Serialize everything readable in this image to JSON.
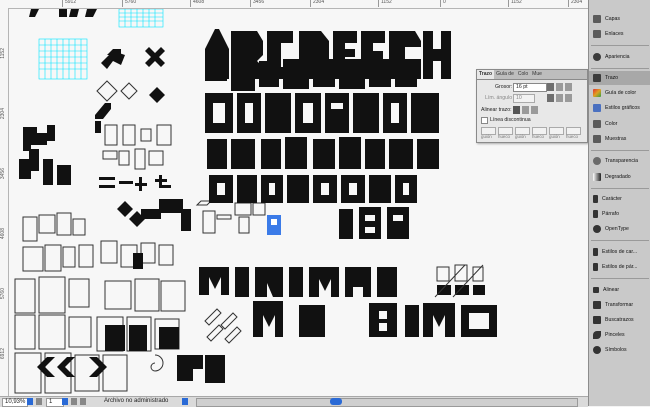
{
  "ruler": {
    "top_ticks": [
      "5912",
      "5760",
      "4608",
      "3456",
      "2304",
      "1152",
      "0",
      "1152",
      "2304",
      "3456",
      "4608",
      "5760",
      "6912"
    ],
    "left_ticks": [
      "0",
      "1152",
      "2304",
      "3456",
      "4608",
      "5760",
      "6912"
    ]
  },
  "status": {
    "zoom": "10,93%",
    "page": "1",
    "file_status": "Archivo no administrado"
  },
  "stroke_panel": {
    "tabs": [
      "Trazo",
      "Guía de",
      "Colo",
      "Mue"
    ],
    "weight_label": "Grosor:",
    "weight_value": "16 pt",
    "miter_label": "Lím. ángulo",
    "miter_value": "10",
    "align_label": "Alinear trazo:",
    "dashed_label": "Línea discontinua",
    "dash_fields": [
      "guión",
      "hueco",
      "guión",
      "hueco",
      "guión",
      "hueco"
    ]
  },
  "dock": {
    "items": [
      {
        "label": "Capas",
        "icon": "layers-icon",
        "color": "#5b5b5b"
      },
      {
        "label": "Enlaces",
        "icon": "links-icon",
        "color": "#5b5b5b"
      },
      {
        "label": "Apariencia",
        "icon": "appearance-icon",
        "color": "#3c3c3c"
      },
      {
        "label": "Trazo",
        "icon": "stroke-icon",
        "color": "#3c3c3c"
      },
      {
        "label": "Guía de color",
        "icon": "color-guide-icon",
        "color": "#e0a020"
      },
      {
        "label": "Estilos gráficos",
        "icon": "graphic-styles-icon",
        "color": "#4a70c0"
      },
      {
        "label": "Color",
        "icon": "color-icon",
        "color": "#5a5a5a"
      },
      {
        "label": "Muestras",
        "icon": "swatches-icon",
        "color": "#5a5a5a"
      },
      {
        "label": "Transparencia",
        "icon": "transparency-icon",
        "color": "#6a6a6a"
      },
      {
        "label": "Degradado",
        "icon": "gradient-icon",
        "color": "#333333"
      },
      {
        "label": "Carácter",
        "icon": "character-icon",
        "color": "#333333"
      },
      {
        "label": "Párrafo",
        "icon": "paragraph-icon",
        "color": "#333333"
      },
      {
        "label": "OpenType",
        "icon": "opentype-icon",
        "color": "#333333"
      },
      {
        "label": "Estilos de car...",
        "icon": "character-styles-icon",
        "color": "#333333"
      },
      {
        "label": "Estilos de pár...",
        "icon": "paragraph-styles-icon",
        "color": "#333333"
      },
      {
        "label": "Alinear",
        "icon": "align-icon",
        "color": "#333333"
      },
      {
        "label": "Transformar",
        "icon": "transform-icon",
        "color": "#333333"
      },
      {
        "label": "Buscatrazos",
        "icon": "pathfinder-icon",
        "color": "#333333"
      },
      {
        "label": "Pinceles",
        "icon": "brushes-icon",
        "color": "#333333"
      },
      {
        "label": "Símbolos",
        "icon": "symbols-icon",
        "color": "#333333"
      }
    ]
  },
  "colors": {
    "accent": "#2a6ad6",
    "selection": "#00e5ff",
    "glyph": "#111111"
  }
}
